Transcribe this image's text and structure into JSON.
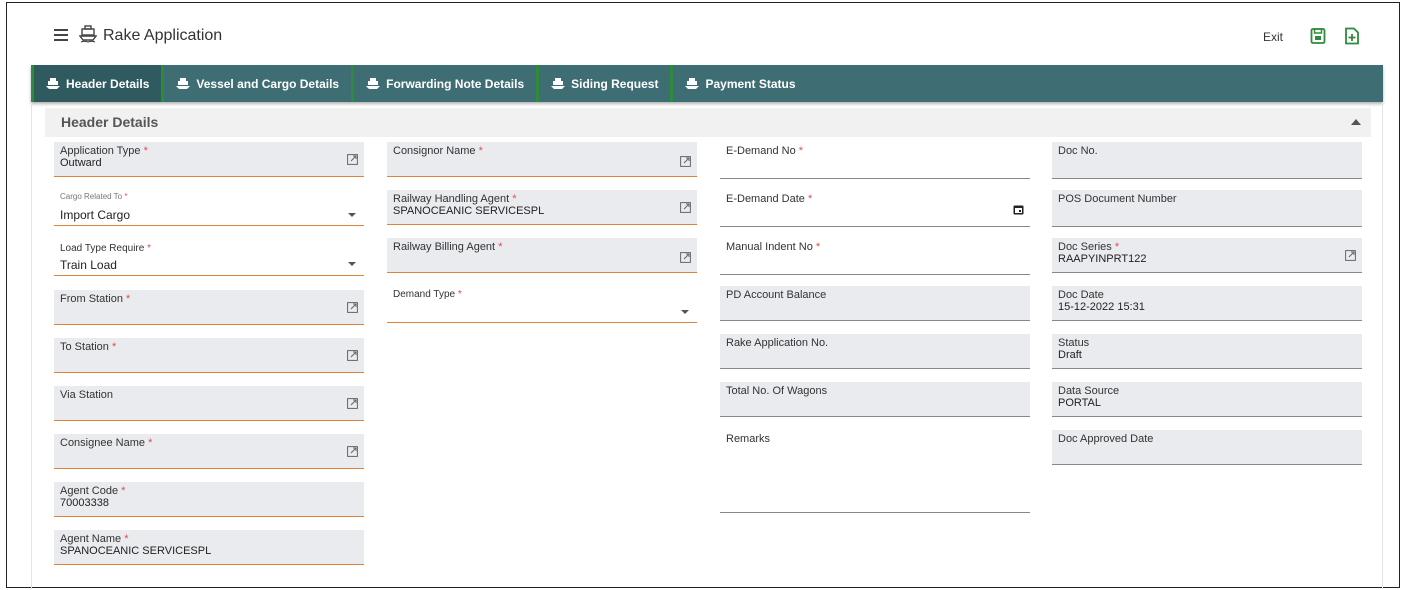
{
  "app": {
    "title": "Rake Application"
  },
  "toolbar": {
    "exit_label": "Exit"
  },
  "tabs": [
    {
      "label": "Header Details"
    },
    {
      "label": "Vessel and Cargo Details"
    },
    {
      "label": "Forwarding Note Details"
    },
    {
      "label": "Siding Request"
    },
    {
      "label": "Payment Status"
    }
  ],
  "section": {
    "title": "Header Details"
  },
  "col1": {
    "application_type": {
      "label": "Application Type",
      "value": "Outward"
    },
    "cargo_related_to": {
      "label": "Cargo Related To",
      "value": "Import Cargo"
    },
    "load_type": {
      "label": "Load Type Require",
      "value": "Train Load"
    },
    "from_station": {
      "label": "From Station",
      "value": ""
    },
    "to_station": {
      "label": "To Station",
      "value": ""
    },
    "via_station": {
      "label": "Via Station",
      "value": ""
    },
    "consignee_name": {
      "label": "Consignee Name",
      "value": ""
    },
    "agent_code": {
      "label": "Agent Code",
      "value": "70003338"
    },
    "agent_name": {
      "label": "Agent Name",
      "value": "SPANOCEANIC SERVICESPL"
    }
  },
  "col2": {
    "consignor_name": {
      "label": "Consignor Name",
      "value": ""
    },
    "railway_handling_agent": {
      "label": "Railway Handling Agent",
      "value": "SPANOCEANIC SERVICESPL"
    },
    "railway_billing_agent": {
      "label": "Railway Billing Agent",
      "value": ""
    },
    "demand_type": {
      "label": "Demand Type",
      "value": ""
    }
  },
  "col3": {
    "e_demand_no": {
      "label": "E-Demand No",
      "value": ""
    },
    "e_demand_date": {
      "label": "E-Demand Date",
      "value": ""
    },
    "manual_indent_no": {
      "label": "Manual Indent No",
      "value": ""
    },
    "pd_account_balance": {
      "label": "PD Account Balance",
      "value": ""
    },
    "rake_application_no": {
      "label": "Rake Application No.",
      "value": ""
    },
    "total_wagons": {
      "label": "Total No. Of Wagons",
      "value": ""
    },
    "remarks": {
      "label": "Remarks",
      "value": ""
    }
  },
  "col4": {
    "doc_no": {
      "label": "Doc No.",
      "value": ""
    },
    "pos_document_number": {
      "label": "POS Document Number",
      "value": ""
    },
    "doc_series": {
      "label": "Doc Series",
      "value": "RAAPYINPRT122"
    },
    "doc_date": {
      "label": "Doc Date",
      "value": "15-12-2022 15:31"
    },
    "status": {
      "label": "Status",
      "value": "Draft"
    },
    "data_source": {
      "label": "Data Source",
      "value": "PORTAL"
    },
    "doc_approved_date": {
      "label": "Doc Approved Date",
      "value": ""
    }
  },
  "required_marker": "*",
  "colors": {
    "tab_bar": "#3f6d74",
    "tab_accent": "#2e8b3a",
    "field_underline": "#e0833a",
    "required": "#e34b4b",
    "field_bg": "#e9ebee"
  }
}
